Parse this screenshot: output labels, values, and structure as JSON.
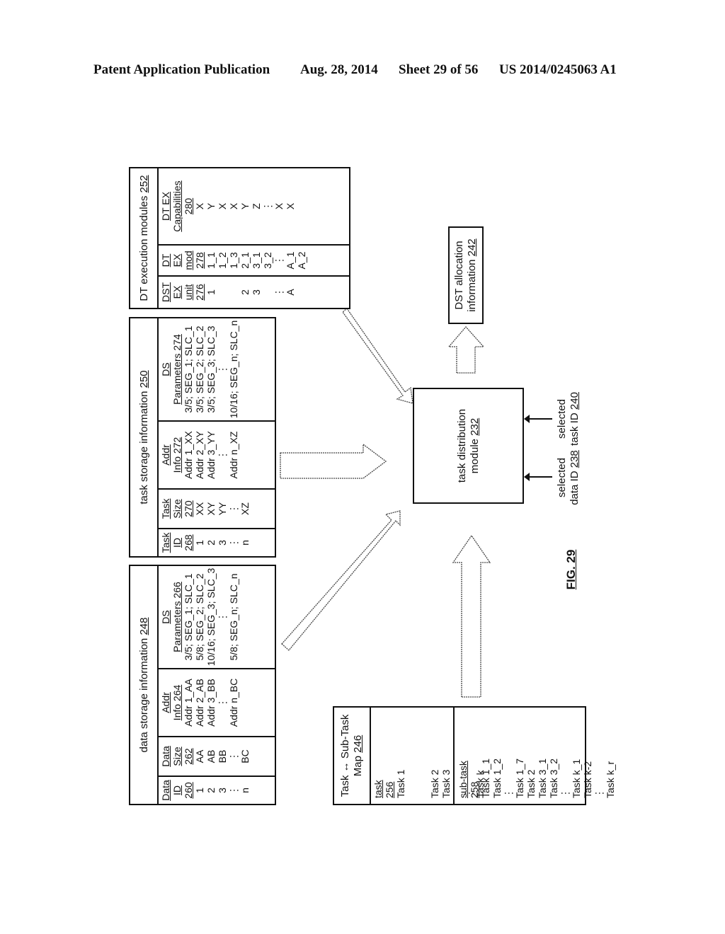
{
  "header": {
    "publication": "Patent Application Publication",
    "date": "Aug. 28, 2014",
    "sheet": "Sheet 29 of 56",
    "patent_number": "US 2014/0245063 A1"
  },
  "data_storage": {
    "title": "data storage information",
    "ref": "248",
    "columns": [
      {
        "header": [
          "Data",
          "ID",
          "260"
        ],
        "cells": [
          "1",
          "2",
          "3",
          "⋮",
          "n"
        ]
      },
      {
        "header": [
          "Data",
          "Size",
          "262"
        ],
        "cells": [
          "AA",
          "AB",
          "BB",
          "⋮",
          "BC"
        ]
      },
      {
        "header": [
          "Addr",
          "Info 264"
        ],
        "cells": [
          "Addr 1_AA",
          "Addr 2_AB",
          "Addr 3_BB",
          "⋮",
          "Addr n_BC"
        ]
      },
      {
        "header": [
          "DS",
          "Parameters 266"
        ],
        "cells": [
          "3/5; SEG_1; SLC_1",
          "5/8; SEG_2; SLC_2",
          "10/16; SEG_3; SLC_3",
          "⋮",
          "5/8; SEG_n; SLC_n"
        ]
      }
    ]
  },
  "task_storage": {
    "title": "task storage information",
    "ref": "250",
    "columns": [
      {
        "header": [
          "Task",
          "ID",
          "268"
        ],
        "cells": [
          "1",
          "2",
          "3",
          "⋮",
          "n"
        ]
      },
      {
        "header": [
          "Task",
          "Size",
          "270"
        ],
        "cells": [
          "XX",
          "XY",
          "YY",
          "⋮",
          "XZ"
        ]
      },
      {
        "header": [
          "Addr",
          "Info 272"
        ],
        "cells": [
          "Addr 1_XX",
          "Addr 2_XY",
          "Addr 3_YY",
          "⋮",
          "Addr n_XZ"
        ]
      },
      {
        "header": [
          "DS",
          "Parameters 274"
        ],
        "cells": [
          "3/5; SEG_1; SLC_1",
          "3/5; SEG_2; SLC_2",
          "3/5; SEG_3; SLC_3",
          "⋮",
          "10/16; SEG_n; SLC_n"
        ]
      }
    ]
  },
  "dt_execution": {
    "title": "DT execution modules",
    "ref": "252",
    "columns": [
      {
        "header": [
          "DST",
          "EX",
          "unit",
          "276"
        ],
        "cells": [
          "1",
          "",
          "",
          "2",
          "3",
          "",
          "⋮",
          "A",
          ""
        ]
      },
      {
        "header": [
          "DT",
          "EX",
          "mod",
          "278"
        ],
        "cells": [
          "1_1",
          "1_2",
          "1_3",
          "2_1",
          "3_1",
          "3_2",
          "⋮",
          "A_1",
          "A_2"
        ]
      },
      {
        "header": [
          "DT EX",
          "Capabilities",
          "280"
        ],
        "cells": [
          "X",
          "Y",
          "X",
          "X",
          "Y",
          "Z",
          "⋮",
          "X",
          "X"
        ]
      }
    ]
  },
  "task_map": {
    "title_line1": "Task ↔ Sub-Task",
    "title_line2": "Map",
    "ref": "246",
    "columns": [
      {
        "header": [
          "task",
          "256"
        ],
        "cells": [
          "Task 1",
          "",
          "",
          "Task 2",
          "Task 3",
          "",
          "⋮",
          "Task k",
          "",
          "",
          ""
        ]
      },
      {
        "header": [
          "sub-task",
          "258"
        ],
        "cells": [
          "Task 1_1",
          "Task 1_2",
          "⋮",
          "Task 1_7",
          "Task 2",
          "Task 3_1",
          "Task 3_2",
          "⋮",
          "Task k_1",
          "Task k-2",
          "⋮",
          "Task k_r"
        ]
      }
    ]
  },
  "task_distribution_module": {
    "line1": "task distribution",
    "line2": "module",
    "ref": "232"
  },
  "dst_allocation": {
    "line1": "DST allocation",
    "line2": "information",
    "ref": "242"
  },
  "inputs": {
    "data_id": {
      "line1": "selected",
      "line2": "data ID",
      "ref": "238"
    },
    "task_id": {
      "line1": "selected",
      "line2": "task ID",
      "ref": "240"
    }
  },
  "figure_label": "FIG. 29"
}
